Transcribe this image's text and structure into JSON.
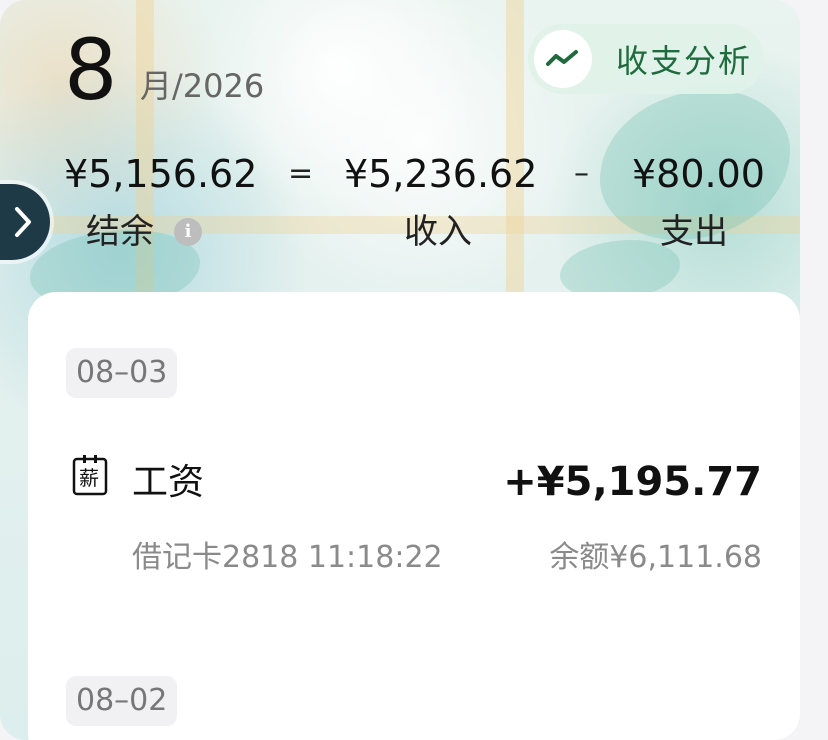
{
  "header": {
    "month_number": "8",
    "month_suffix": "月/2026",
    "analysis_button_label": "收支分析",
    "analysis_icon": "trend-line-icon",
    "expand_icon": "chevron-right-icon"
  },
  "summary": {
    "balance": "¥5,156.62",
    "equals": "=",
    "income": "¥5,236.62",
    "minus": "–",
    "expense": "¥80.00",
    "balance_label": "结余",
    "income_label": "收入",
    "expense_label": "支出",
    "info_icon": "info-icon"
  },
  "groups": [
    {
      "date": "08–03",
      "transactions": [
        {
          "icon": "salary-icon",
          "icon_text": "薪",
          "title": "工资",
          "amount": "+¥5,195.77",
          "meta": "借记卡2818 11:18:22",
          "balance": "余额¥6,111.68"
        }
      ]
    },
    {
      "date": "08–02",
      "transactions": []
    }
  ],
  "colors": {
    "accent_green": "#1f6b3e",
    "side_tab": "#1e3a46",
    "text_primary": "#111111",
    "text_secondary": "#8a8a8a"
  }
}
